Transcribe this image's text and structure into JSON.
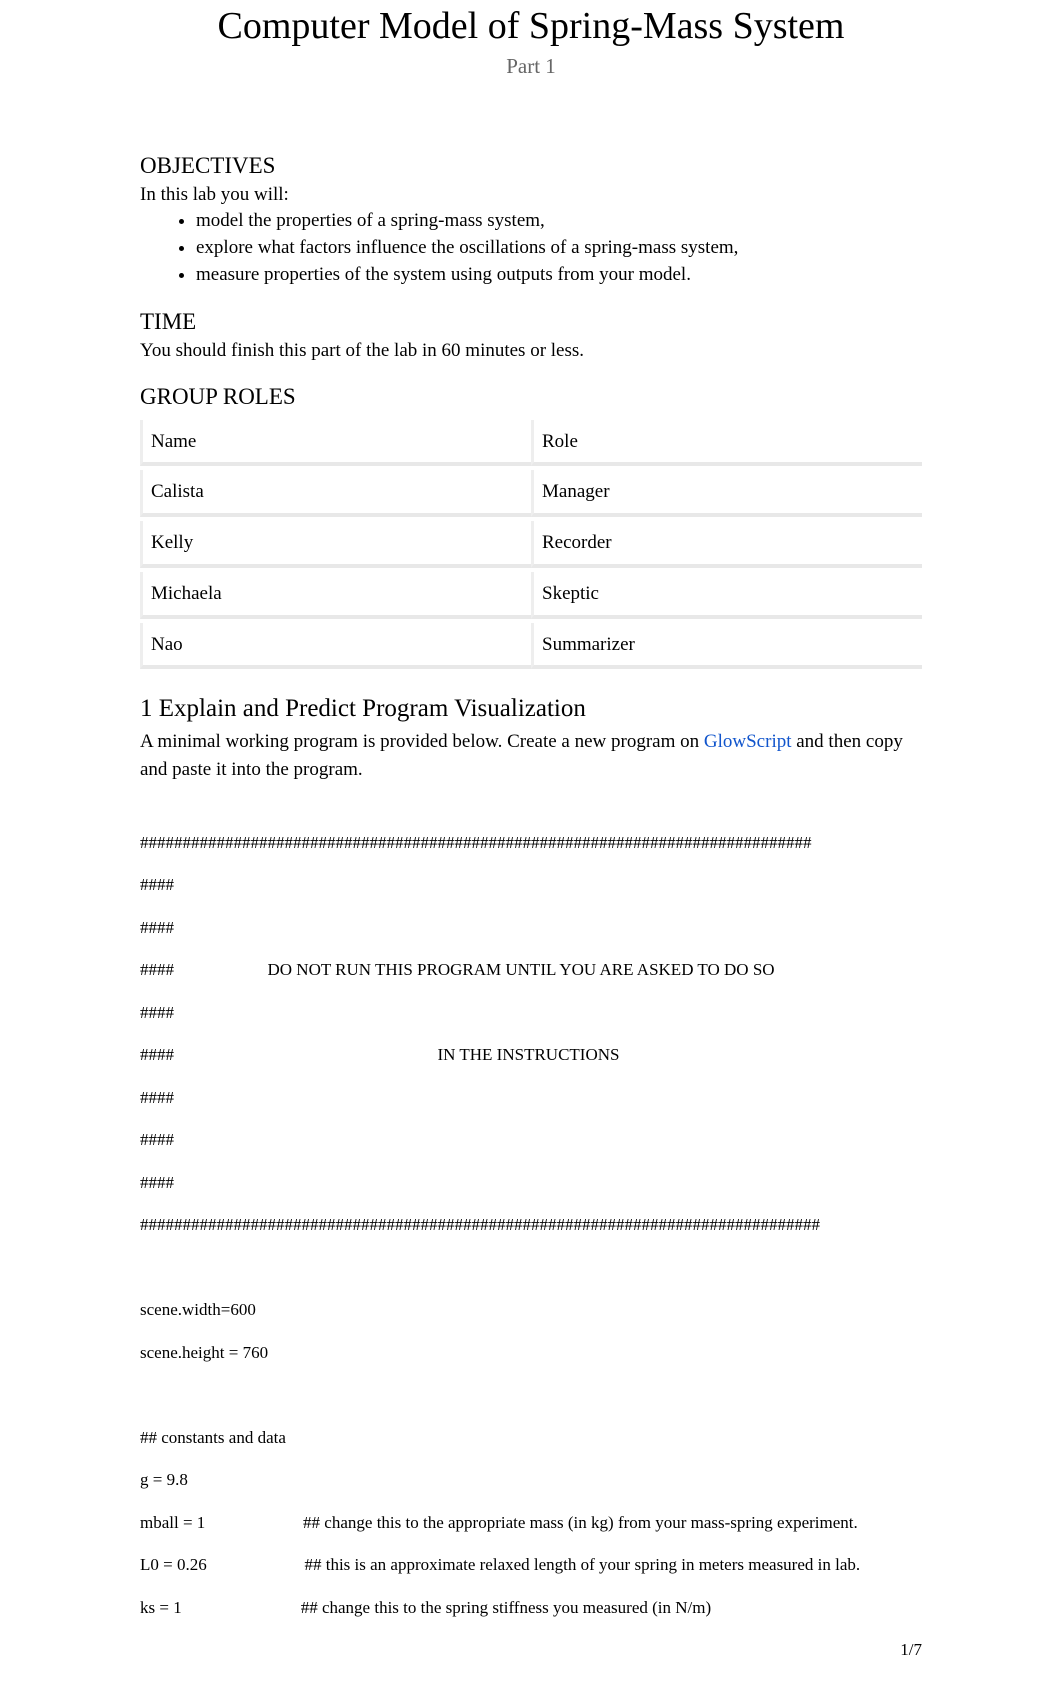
{
  "header": {
    "title": "Computer Model of Spring-Mass System",
    "subtitle": "Part 1"
  },
  "objectives": {
    "heading": "OBJECTIVES",
    "intro": "In this lab you will:",
    "items": [
      "model the properties of a spring-mass system,",
      "explore what factors influence the oscillations of a spring-mass system,",
      "measure properties of the system using outputs from your model."
    ]
  },
  "time": {
    "heading": "TIME",
    "text": "You should finish this part of the lab in 60 minutes or less."
  },
  "roles": {
    "heading": "GROUP ROLES",
    "header": {
      "name": "Name",
      "role": "Role"
    },
    "rows": [
      {
        "name": "Calista",
        "role": "Manager"
      },
      {
        "name": "Kelly",
        "role": "Recorder"
      },
      {
        "name": "Michaela",
        "role": "Skeptic"
      },
      {
        "name": "Nao",
        "role": "Summarizer"
      }
    ]
  },
  "section1": {
    "heading": "1 Explain and Predict Program Visualization",
    "intro_pre": "A minimal working program     is provided below. Create a new program on ",
    "link_text": "GlowScript",
    "intro_post": "  and then copy and paste it into the program."
  },
  "code": {
    "l00": "###############################################################################",
    "l01": "####",
    "l02": "####",
    "l03": "####                      DO NOT RUN THIS PROGRAM UNTIL YOU ARE ASKED TO DO SO",
    "l04": "####",
    "l05": "####                                                              IN THE INSTRUCTIONS",
    "l06": "####",
    "l07": "####",
    "l08": "####",
    "l09": "################################################################################",
    "blank": "",
    "l10": "scene.width=600",
    "l11": "scene.height = 760",
    "l12": "## constants and data",
    "l13": "g = 9.8",
    "l14": "mball = 1                       ## change this to the appropriate mass (in kg) from your mass-spring experiment.",
    "l15": "L0 = 0.26                       ## this is an approximate relaxed length of your spring in meters measured in lab.",
    "l16": "ks = 1                            ## change this to the spring stiffness you measured (in N/m)"
  },
  "footer": {
    "page": "1/7"
  }
}
